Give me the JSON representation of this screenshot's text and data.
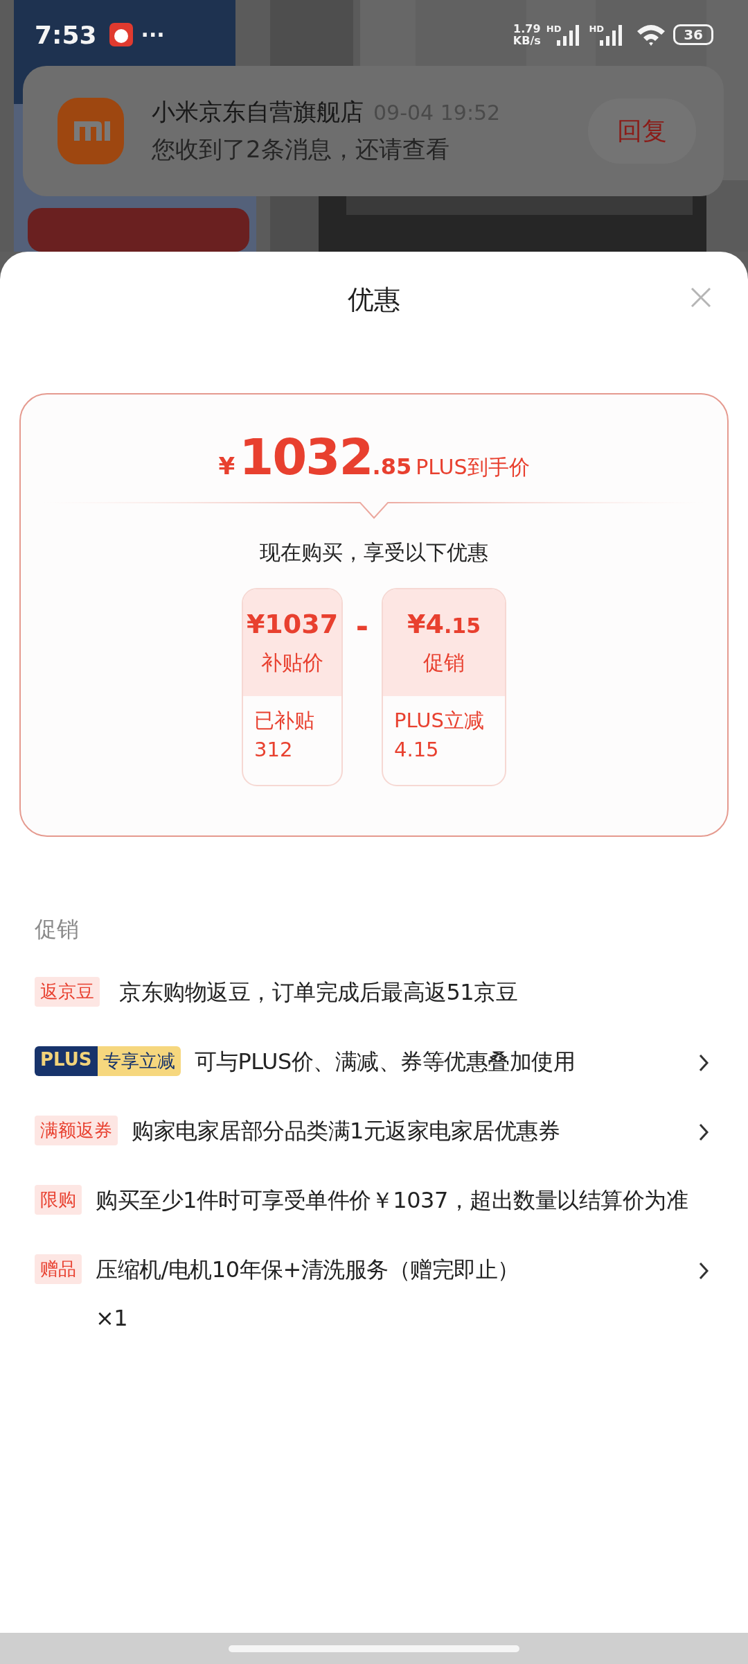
{
  "status_bar": {
    "time": "7:53",
    "more": "···",
    "speed": "1.79",
    "speed_unit": "KB/s",
    "network_labels": [
      "HD",
      "HD"
    ],
    "battery": "36"
  },
  "notification": {
    "title": "小米京东自营旗舰店",
    "time": "09-04 19:52",
    "message": "您收到了2条消息，还请查看",
    "action": "回复"
  },
  "sheet": {
    "title": "优惠"
  },
  "price_card": {
    "currency": "¥",
    "integer": "1032",
    "decimal": ".85",
    "label": "PLUS到手价",
    "subtitle": "现在购买，享受以下优惠",
    "operator": "-",
    "breakdown": [
      {
        "currency": "¥",
        "amount": "1037",
        "label": "补贴价",
        "detail_lines": [
          "已补贴",
          "312"
        ]
      },
      {
        "currency": "¥",
        "amount": "4",
        "decimal": ".15",
        "label": "促销",
        "detail_lines": [
          "PLUS立减",
          "4.15"
        ]
      }
    ]
  },
  "promotions": {
    "title": "促销",
    "items": [
      {
        "kind": "tag",
        "tag": "返京豆",
        "text": "京东购物返豆，订单完成后最高返51京豆",
        "arrow": false
      },
      {
        "kind": "plus",
        "brand": "PLUS",
        "tag": "专享立减",
        "text": "可与PLUS价、满减、券等优惠叠加使用",
        "arrow": true
      },
      {
        "kind": "tag",
        "tag": "满额返券",
        "text": "购家电家居部分品类满1元返家电家居优惠券",
        "arrow": true
      },
      {
        "kind": "tag",
        "tag": "限购",
        "text": "购买至少1件时可享受单件价￥1037，超出数量以结算价为准",
        "arrow": false
      },
      {
        "kind": "tag",
        "tag": "赠品",
        "text": "压缩机/电机10年保+清洗服务（赠完即止）",
        "quantity": "×1",
        "arrow": true
      }
    ]
  }
}
